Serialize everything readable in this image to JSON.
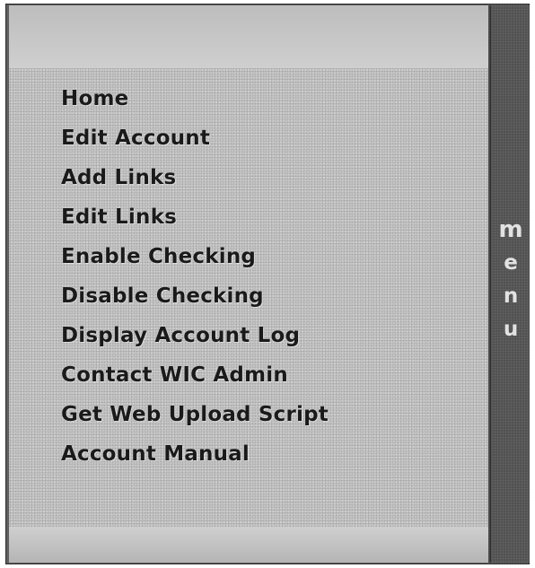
{
  "menu": {
    "items": [
      {
        "label": "Home"
      },
      {
        "label": "Edit Account"
      },
      {
        "label": "Add Links"
      },
      {
        "label": "Edit Links"
      },
      {
        "label": "Enable Checking"
      },
      {
        "label": "Disable Checking"
      },
      {
        "label": "Display Account Log"
      },
      {
        "label": "Contact WIC Admin"
      },
      {
        "label": "Get Web Upload Script"
      },
      {
        "label": "Account Manual"
      }
    ]
  },
  "side_tab": {
    "letters": [
      "m",
      "e",
      "n",
      "u"
    ]
  }
}
